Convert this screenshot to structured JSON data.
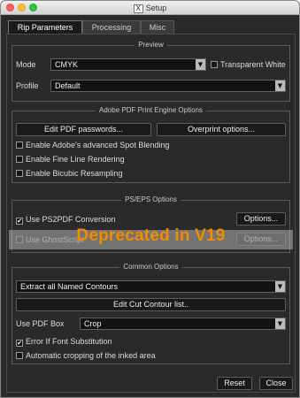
{
  "window": {
    "title": "Setup",
    "x11_glyph": "X"
  },
  "tabs": [
    {
      "label": "Rip Parameters",
      "active": true
    },
    {
      "label": "Processing",
      "active": false
    },
    {
      "label": "Misc",
      "active": false
    }
  ],
  "preview": {
    "title": "Preview",
    "mode_label": "Mode",
    "mode_value": "CMYK",
    "transparent_white_label": "Transparent White",
    "transparent_white_checked": false,
    "profile_label": "Profile",
    "profile_value": "Default"
  },
  "adobe_pdf": {
    "title": "Adobe PDF Print Engine Options",
    "edit_passwords_label": "Edit PDF passwords...",
    "overprint_label": "Overprint options...",
    "spot_blending_label": "Enable Adobe's advanced Spot Blending",
    "spot_blending_checked": false,
    "fine_line_label": "Enable Fine Line Rendering",
    "fine_line_checked": false,
    "bicubic_label": "Enable Bicubic Resampling",
    "bicubic_checked": false
  },
  "ps_eps": {
    "title": "PS/EPS Options",
    "ps2pdf_label": "Use PS2PDF Conversion",
    "ps2pdf_checked": true,
    "ps2pdf_options_label": "Options...",
    "ghostscript_label": "Use GhostScript",
    "ghostscript_checked": false,
    "ghostscript_options_label": "Options...",
    "deprecated_overlay": "Deprecated in V19"
  },
  "common": {
    "title": "Common Options",
    "contours_value": "Extract all Named Contours",
    "edit_contour_label": "Edit Cut Contour list..",
    "pdf_box_label": "Use PDF Box",
    "pdf_box_value": "Crop",
    "font_error_label": "Error If Font Substitution",
    "font_error_checked": true,
    "auto_crop_label": "Automatic cropping of the inked area",
    "auto_crop_checked": false
  },
  "footer": {
    "reset_label": "Reset",
    "close_label": "Close"
  },
  "colors": {
    "window_bg": "#2a2a2a",
    "field_bg": "#131313",
    "overlay_text": "#f28c00"
  },
  "icons": {
    "dropdown_arrow": "▼",
    "check_mark": "✔"
  }
}
